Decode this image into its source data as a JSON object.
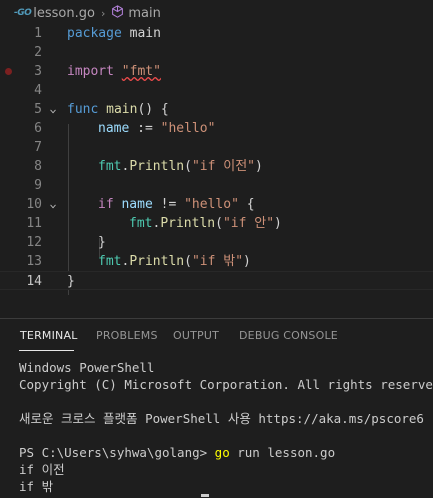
{
  "breadcrumb": {
    "icon": "go-file-icon",
    "icon_text": "-GO",
    "file": "lesson.go",
    "symbol_icon": "function-cube-icon",
    "symbol": "main"
  },
  "editor": {
    "active_line": "14",
    "breakpoint_line": "3",
    "lines": [
      {
        "n": "1"
      },
      {
        "n": "2"
      },
      {
        "n": "3"
      },
      {
        "n": "4"
      },
      {
        "n": "5"
      },
      {
        "n": "6"
      },
      {
        "n": "7"
      },
      {
        "n": "8"
      },
      {
        "n": "9"
      },
      {
        "n": "10"
      },
      {
        "n": "11"
      },
      {
        "n": "12"
      },
      {
        "n": "13"
      },
      {
        "n": "14"
      }
    ],
    "tokens": {
      "l1_kw": "package",
      "l1_name": " main",
      "l3_kw": "import",
      "l3_str": "\"fmt\"",
      "l5_kw": "func",
      "l5_fn": "main",
      "l5_rest": "() {",
      "l6_var": "name",
      "l6_op": " := ",
      "l6_str": "\"hello\"",
      "l8_pkg": "fmt",
      "l8_dot": ".",
      "l8_fn": "Println",
      "l8_open": "(",
      "l8_str": "\"if 이전\"",
      "l8_close": ")",
      "l10_kw": "if",
      "l10_var": "name",
      "l10_op": " != ",
      "l10_str": "\"hello\"",
      "l10_brace": " {",
      "l11_pkg": "fmt",
      "l11_dot": ".",
      "l11_fn": "Println",
      "l11_open": "(",
      "l11_str": "\"if 안\"",
      "l11_close": ")",
      "l12_brace": "}",
      "l13_pkg": "fmt",
      "l13_dot": ".",
      "l13_fn": "Println",
      "l13_open": "(",
      "l13_str": "\"if 밖\"",
      "l13_close": ")",
      "l14_brace": "}"
    }
  },
  "panel": {
    "tabs": [
      {
        "label": "TERMINAL",
        "active": true
      },
      {
        "label": "PROBLEMS",
        "active": false
      },
      {
        "label": "OUTPUT",
        "active": false
      },
      {
        "label": "DEBUG CONSOLE",
        "active": false
      }
    ],
    "terminal": {
      "line1": "Windows PowerShell",
      "line2": "Copyright (C) Microsoft Corporation. All rights reserved.",
      "line3": "새로운 크로스 플랫폼 PowerShell 사용 https://aka.ms/pscore6",
      "prompt": "PS C:\\Users\\syhwa\\golang> ",
      "command": "go",
      "command_args": " run lesson.go",
      "out1": "if 이전",
      "out2": "if 밖"
    }
  },
  "colors": {
    "background": "#1e1e1e",
    "keyword": "#569cd6",
    "control": "#c586c0",
    "function": "#dcdcaa",
    "string": "#ce9178",
    "variable": "#9cdcfe",
    "package": "#4ec9b0",
    "breakpoint": "#7c2020",
    "command": "#ffff00"
  }
}
